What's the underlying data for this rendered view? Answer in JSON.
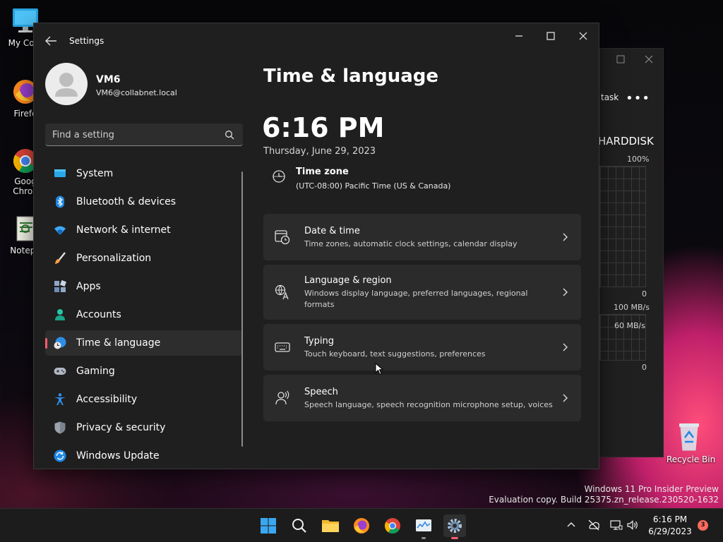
{
  "desktop": {
    "icons": [
      {
        "label": "My Com",
        "icon": "computer-icon"
      },
      {
        "label": "Firefo",
        "icon": "firefox-icon"
      },
      {
        "label": "Goog",
        "label2": "Chron",
        "icon": "chrome-icon"
      },
      {
        "label": "Notepa",
        "icon": "notepad-icon"
      },
      {
        "label": "Recycle Bin",
        "icon": "recycle-bin-icon"
      }
    ],
    "watermark": {
      "line1": "Windows 11 Pro Insider Preview",
      "line2": "Evaluation copy. Build 25375.zn_release.230520-1632"
    }
  },
  "task_manager": {
    "task_label": "task",
    "more_label": "•••",
    "section_title": "HARDDISK",
    "graph1_top": "100%",
    "graph1_bottom": "0",
    "graph2_top": "100 MB/s",
    "graph2_mid": "60 MB/s",
    "graph2_bottom": "0"
  },
  "window": {
    "title": "Settings",
    "back_icon": "back-arrow-icon",
    "controls": [
      "minimize-icon",
      "maximize-icon",
      "close-icon"
    ]
  },
  "profile": {
    "name": "VM6",
    "email": "VM6@collabnet.local"
  },
  "search": {
    "placeholder": "Find a setting"
  },
  "nav": {
    "items": [
      {
        "label": "System",
        "icon": "system-icon",
        "active": false
      },
      {
        "label": "Bluetooth & devices",
        "icon": "bluetooth-icon",
        "active": false
      },
      {
        "label": "Network & internet",
        "icon": "wifi-icon",
        "active": false
      },
      {
        "label": "Personalization",
        "icon": "brush-icon",
        "active": false
      },
      {
        "label": "Apps",
        "icon": "apps-icon",
        "active": false
      },
      {
        "label": "Accounts",
        "icon": "accounts-icon",
        "active": false
      },
      {
        "label": "Time & language",
        "icon": "globe-clock-icon",
        "active": true
      },
      {
        "label": "Gaming",
        "icon": "gamepad-icon",
        "active": false
      },
      {
        "label": "Accessibility",
        "icon": "accessibility-icon",
        "active": false
      },
      {
        "label": "Privacy & security",
        "icon": "shield-icon",
        "active": false
      },
      {
        "label": "Windows Update",
        "icon": "update-icon",
        "active": false
      }
    ]
  },
  "main": {
    "title": "Time & language",
    "clock": "6:16 PM",
    "date": "Thursday, June 29, 2023",
    "time_zone": {
      "title": "Time zone",
      "value": "(UTC-08:00) Pacific Time (US & Canada)"
    },
    "cards": [
      {
        "title": "Date & time",
        "desc": "Time zones, automatic clock settings, calendar display",
        "icon": "calendar-clock-icon"
      },
      {
        "title": "Language & region",
        "desc": "Windows display language, preferred languages, regional formats",
        "icon": "language-icon"
      },
      {
        "title": "Typing",
        "desc": "Touch keyboard, text suggestions, preferences",
        "icon": "keyboard-icon"
      },
      {
        "title": "Speech",
        "desc": "Speech language, speech recognition microphone setup, voices",
        "icon": "speech-icon"
      }
    ]
  },
  "taskbar": {
    "apps": [
      "start-icon",
      "search-icon",
      "file-explorer-icon",
      "firefox-icon",
      "chrome-icon",
      "task-manager-icon",
      "settings-icon"
    ],
    "active_app": "settings-icon",
    "tray_icons": [
      "chevron-up-icon",
      "network-offline-icon",
      "display-icon",
      "volume-icon"
    ],
    "time": "6:16 PM",
    "date": "6/29/2023",
    "notification_count": "3",
    "accent": "#ff5b6e"
  }
}
